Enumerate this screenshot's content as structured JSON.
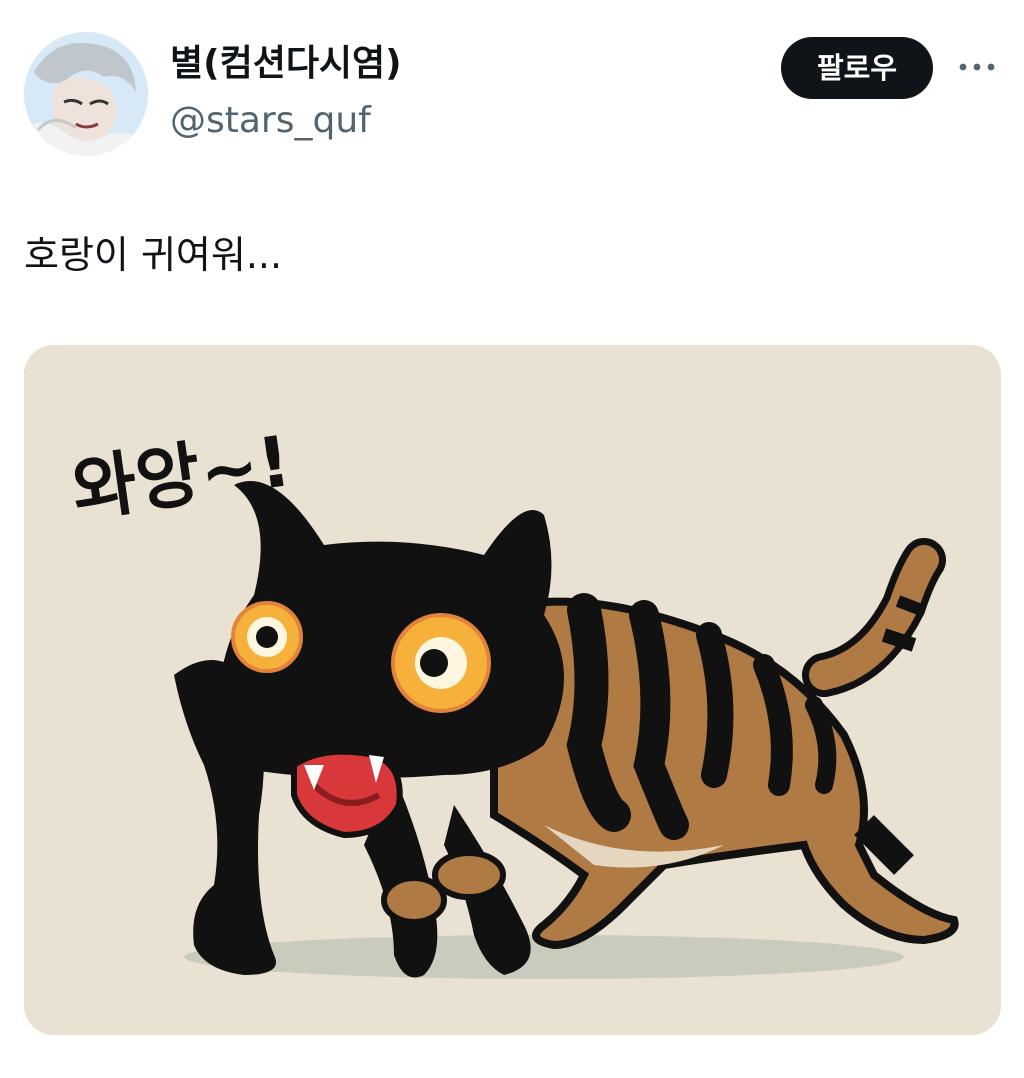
{
  "profile": {
    "display_name": "별(컴션다시염)",
    "handle": "@stars_quf",
    "avatar_icon": "user-avatar"
  },
  "actions": {
    "follow_label": "팔로우",
    "more_icon": "more-horizontal-icon"
  },
  "tweet": {
    "text": "호랑이 귀여워..."
  },
  "media": {
    "caption_in_image": "와앙~!",
    "background_color": "#e9e1d1",
    "tiger_orange": "#b07a44",
    "eye_color": "#f5b13a"
  }
}
